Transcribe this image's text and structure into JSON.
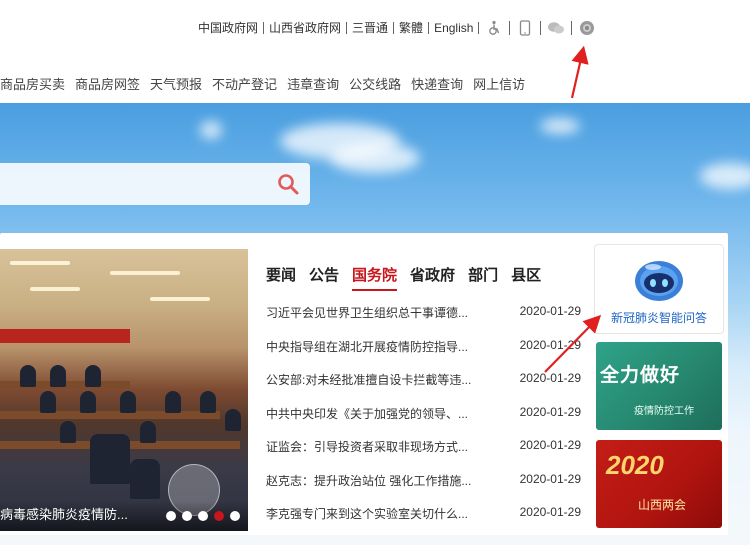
{
  "top_links": [
    "中国政府网",
    "山西省政府网",
    "三晋通",
    "繁體",
    "English"
  ],
  "service_nav": [
    "商品房买卖",
    "商品房网签",
    "天气预报",
    "不动产登记",
    "违章查询",
    "公交线路",
    "快递查询",
    "网上信访"
  ],
  "photo": {
    "caption": "病毒感染肺炎疫情防...",
    "dots": 5,
    "active_dot": 3
  },
  "tabs": [
    {
      "label": "要闻",
      "active": false
    },
    {
      "label": "公告",
      "active": false
    },
    {
      "label": "国务院",
      "active": true
    },
    {
      "label": "省政府",
      "active": false
    },
    {
      "label": "部门",
      "active": false
    },
    {
      "label": "县区",
      "active": false
    }
  ],
  "news": [
    {
      "title": "习近平会见世界卫生组织总干事谭德...",
      "date": "2020-01-29"
    },
    {
      "title": "中央指导组在湖北开展疫情防控指导...",
      "date": "2020-01-29"
    },
    {
      "title": "公安部:对未经批准擅自设卡拦截等违...",
      "date": "2020-01-29"
    },
    {
      "title": "中共中央印发《关于加强党的领导、...",
      "date": "2020-01-29"
    },
    {
      "title": "证监会：引导投资者采取非现场方式...",
      "date": "2020-01-29"
    },
    {
      "title": "赵克志：提升政治站位 强化工作措施...",
      "date": "2020-01-29"
    },
    {
      "title": "李克强专门来到这个实验室关切什么...",
      "date": "2020-01-29"
    }
  ],
  "sidebar": {
    "ai_label": "新冠肺炎智能问答",
    "promo1_big": "全力做好",
    "promo1_small": "疫情防控工作",
    "promo2_big": "2020",
    "promo2_small": "山西两会"
  },
  "colors": {
    "accent_red": "#c8161d",
    "link_blue": "#1d64c4",
    "arrow_red": "#e02020"
  },
  "icons": {
    "top": [
      "accessibility-icon",
      "mobile-icon",
      "wechat-icon",
      "weibo-icon"
    ],
    "search": "search-icon"
  }
}
